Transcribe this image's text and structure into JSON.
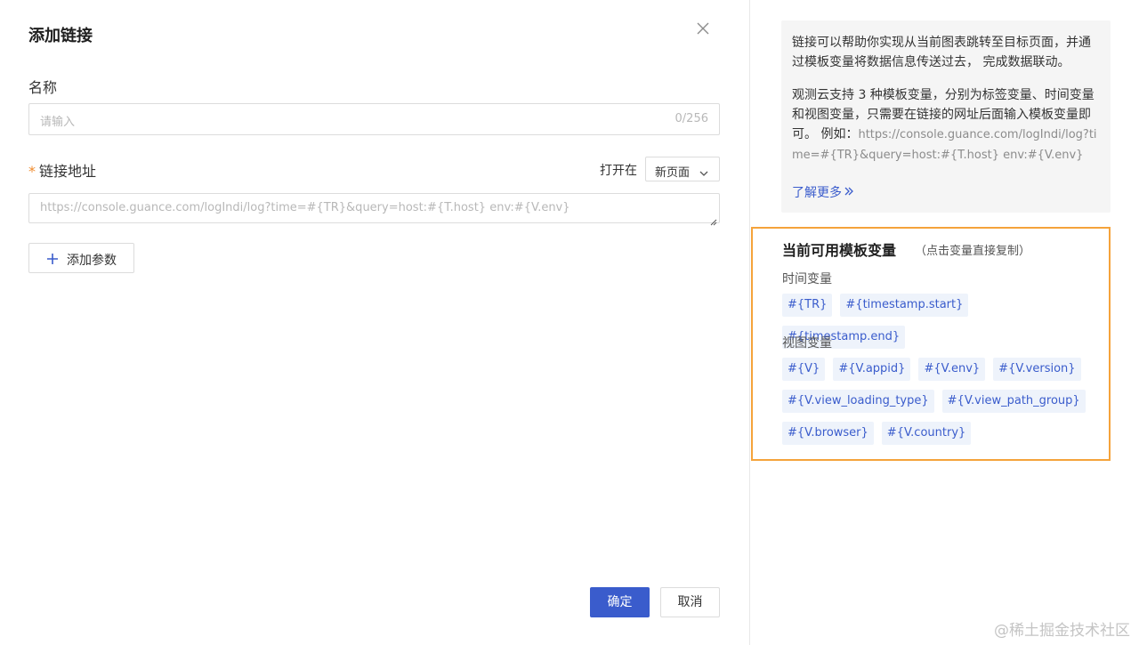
{
  "dialog": {
    "title": "添加链接",
    "name_label": "名称",
    "name_placeholder": "请输入",
    "name_count": "0/256",
    "link_label": "链接地址",
    "link_required_mark": "*",
    "open_in_label": "打开在",
    "open_in_value": "新页面",
    "link_placeholder": "https://console.guance.com/logIndi/log?time=#{TR}&query=host:#{T.host} env:#{V.env}",
    "add_param_label": "添加参数",
    "confirm_label": "确定",
    "cancel_label": "取消"
  },
  "help": {
    "para1": "链接可以帮助你实现从当前图表跳转至目标页面，并通过模板变量将数据信息传送过去， 完成数据联动。",
    "para2": "观测云支持 3 种模板变量，分别为标签变量、时间变量和视图变量，只需要在链接的网址后面输入模板变量即可。 例如：",
    "example_url": "https://console.guance.com/logIndi/log?time=#{TR}&query=host:#{T.host} env:#{V.env}",
    "learn_more": "了解更多"
  },
  "variables": {
    "title": "当前可用模板变量",
    "hint": "（点击变量直接复制）",
    "time_group_label": "时间变量",
    "time_vars": [
      "#{TR}",
      "#{timestamp.start}",
      "#{timestamp.end}"
    ],
    "view_group_label": "视图变量",
    "view_vars": [
      "#{V}",
      "#{V.appid}",
      "#{V.env}",
      "#{V.version}",
      "#{V.view_loading_type}",
      "#{V.view_path_group}",
      "#{V.browser}",
      "#{V.country}"
    ]
  },
  "watermark": "@稀土掘金技术社区",
  "colors": {
    "primary": "#3a5ccc",
    "highlight_border": "#f5a33b",
    "tag_bg": "#eef3fb",
    "required": "#f08c2e"
  }
}
